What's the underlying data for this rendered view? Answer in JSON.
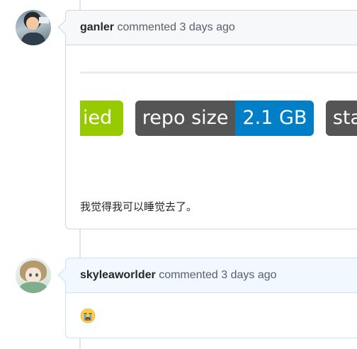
{
  "timeline": {
    "comments": [
      {
        "author": "ganler",
        "action": "commented 3 days ago",
        "badges": {
          "partial_badge_text": "ied",
          "repo_size_label": "repo size",
          "repo_size_value": "2.1 GB",
          "partial_badge_label": "sta"
        },
        "body": "我觉得我可以睡觉去了。"
      },
      {
        "author": "skyleaworlder",
        "action": "commented 3 days ago",
        "reaction_icon": "crying-face-emoji"
      }
    ]
  },
  "colors": {
    "badge_green": "#97ca00",
    "badge_gray": "#555555",
    "badge_blue": "#007ec6",
    "header_bg": "#f6f8fa",
    "highlight_header_bg": "#f1f8ff"
  }
}
